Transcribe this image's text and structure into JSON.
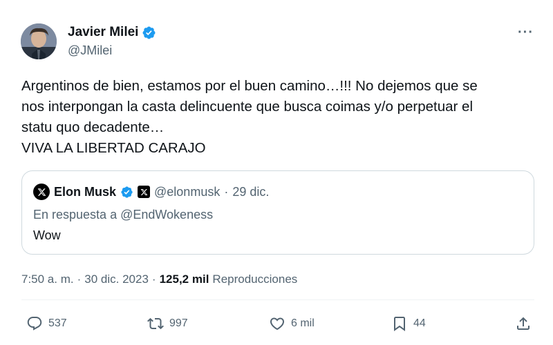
{
  "author": {
    "name": "Javier Milei",
    "handle": "@JMilei"
  },
  "tweet": {
    "text": "Argentinos de bien, estamos por el buen camino…!!! No dejemos que se\nnos interpongan la casta delincuente que busca coimas y/o perpetuar el\nstatu quo decadente…\nVIVA LA LIBERTAD CARAJO"
  },
  "quote": {
    "name": "Elon Musk",
    "handle": "@elonmusk",
    "separator": "·",
    "date": "29 dic.",
    "reply_to": "En respuesta a @EndWokeness",
    "text": "Wow"
  },
  "meta": {
    "time": "7:50 a. m.",
    "sep1": "·",
    "date": "30 dic. 2023",
    "sep2": "·",
    "views_count": "125,2 mil",
    "views_label": "Reproducciones"
  },
  "actions": {
    "replies": "537",
    "reposts": "997",
    "likes": "6 mil",
    "bookmarks": "44"
  },
  "colors": {
    "verified_blue": "#1d9bf0",
    "secondary_text": "#536471",
    "border": "#cfd9de"
  }
}
